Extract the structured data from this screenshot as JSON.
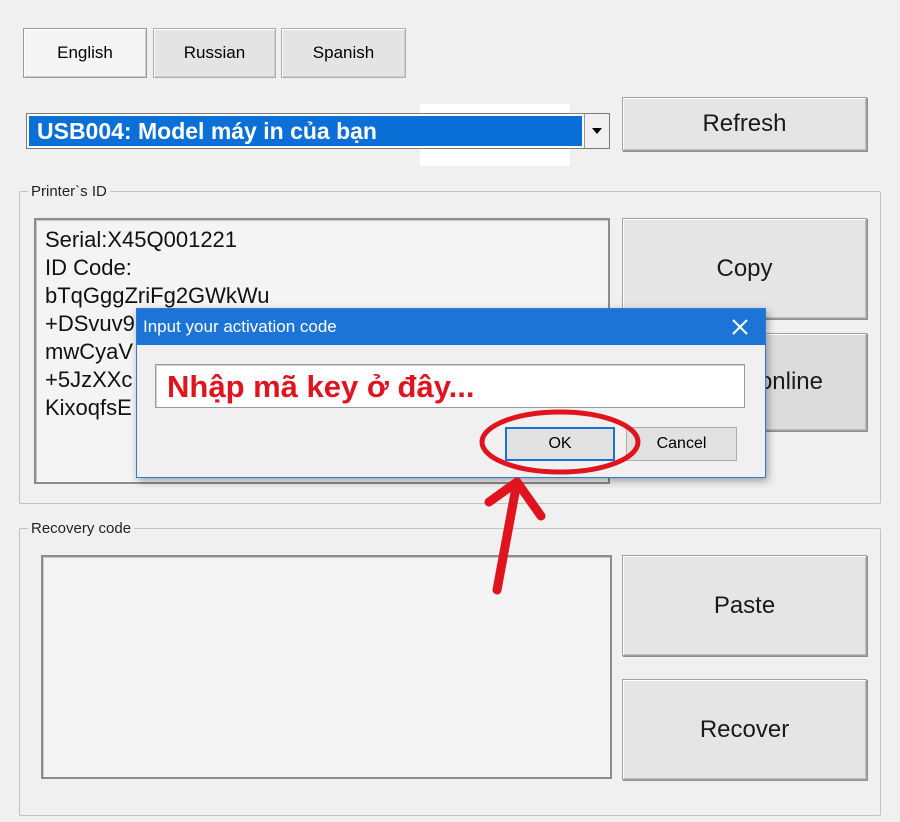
{
  "languages": [
    {
      "label": "English",
      "active": true
    },
    {
      "label": "Russian",
      "active": false
    },
    {
      "label": "Spanish",
      "active": false
    }
  ],
  "printer_select": {
    "selected": "USB004: Model máy in của bạn"
  },
  "buttons": {
    "refresh": "Refresh",
    "copy": "Copy",
    "online_partial": "online",
    "paste": "Paste",
    "recover": "Recover"
  },
  "printer_id_group": {
    "label": "Printer`s ID",
    "lines": [
      "Serial:X45Q001221",
      "ID Code:",
      "bTqGggZriFg2GWkWu",
      "+DSvuv9",
      "mwCyaV",
      "+5JzXXc",
      "KixoqfsE"
    ]
  },
  "recovery_group": {
    "label": "Recovery code",
    "value": ""
  },
  "dialog": {
    "title": "Input your activation code",
    "input_value": "Nhập mã key ở đây...",
    "ok_label": "OK",
    "cancel_label": "Cancel"
  },
  "colors": {
    "annotation": "#e0141e",
    "selection": "#0a6fd6",
    "dialog_title": "#1b74d6"
  }
}
